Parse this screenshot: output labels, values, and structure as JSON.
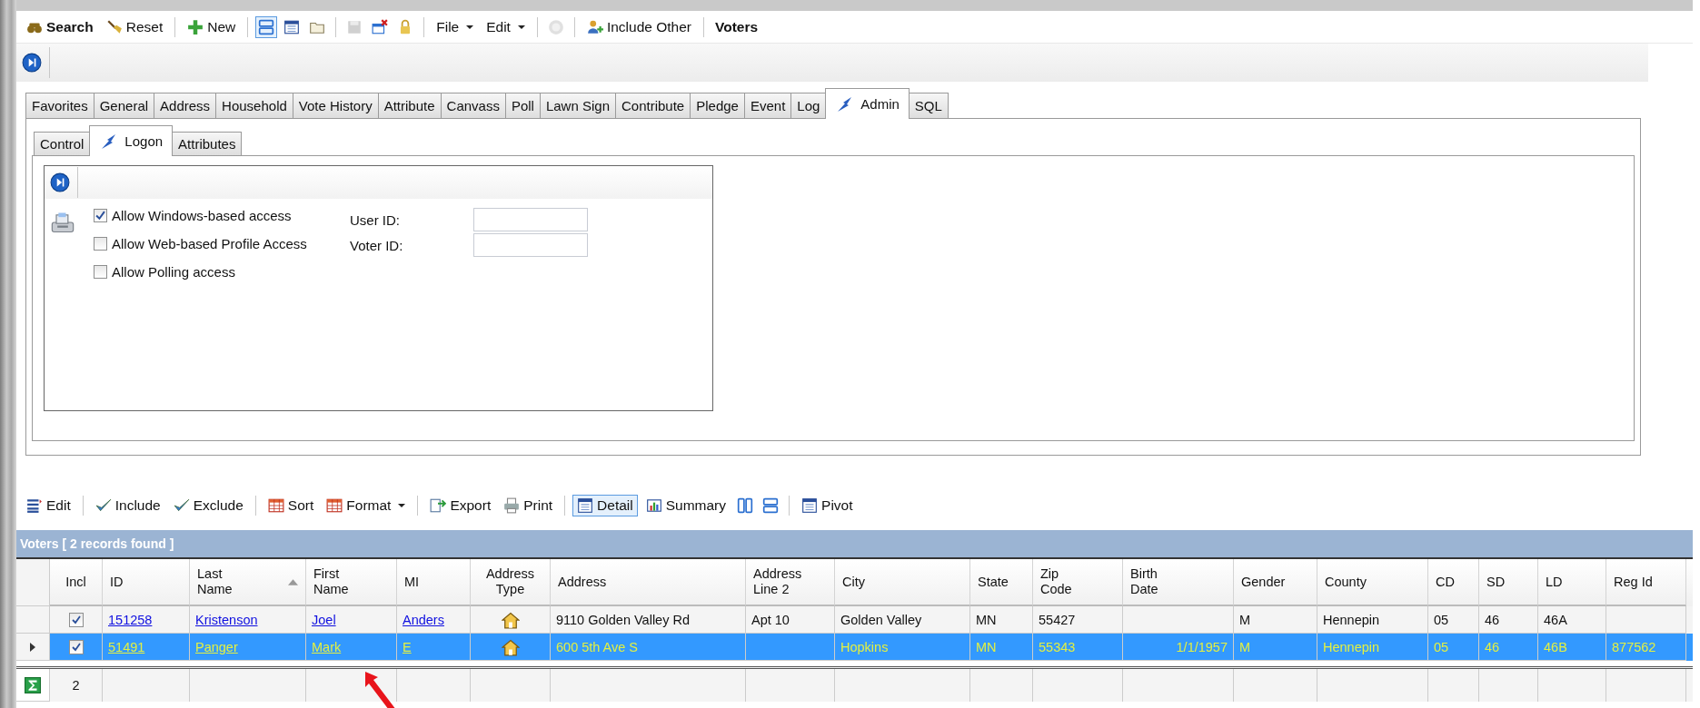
{
  "toolbar": {
    "groups": [
      [
        {
          "kind": "button",
          "label": "Search",
          "bold": true
        },
        {
          "kind": "button",
          "label": "Reset",
          "bold": false
        }
      ],
      [
        {
          "kind": "button",
          "label": "New",
          "bold": false
        }
      ],
      [
        {
          "kind": "icon",
          "selected": true,
          "disabled": false
        },
        {
          "kind": "icon",
          "selected": false,
          "disabled": false
        },
        {
          "kind": "icon",
          "selected": false,
          "disabled": false
        }
      ],
      [
        {
          "kind": "icon",
          "selected": false,
          "disabled": true
        },
        {
          "kind": "icon",
          "selected": false,
          "disabled": false
        },
        {
          "kind": "icon",
          "selected": false,
          "disabled": false
        }
      ],
      [
        {
          "kind": "menu",
          "label": "File",
          "bold": false
        },
        {
          "kind": "menu",
          "label": "Edit",
          "bold": false
        }
      ],
      [
        {
          "kind": "icon",
          "selected": false,
          "disabled": true
        }
      ],
      [
        {
          "kind": "button",
          "label": "Include Other",
          "bold": false
        }
      ],
      [
        {
          "kind": "title",
          "label": "Voters",
          "bold": true
        }
      ]
    ]
  },
  "tabs": [
    {
      "label": "Favorites",
      "selected": false
    },
    {
      "label": "General",
      "selected": false
    },
    {
      "label": "Address",
      "selected": false
    },
    {
      "label": "Household",
      "selected": false
    },
    {
      "label": "Vote History",
      "selected": false
    },
    {
      "label": "Attribute",
      "selected": false
    },
    {
      "label": "Canvass",
      "selected": false
    },
    {
      "label": "Poll",
      "selected": false
    },
    {
      "label": "Lawn Sign",
      "selected": false
    },
    {
      "label": "Contribute",
      "selected": false
    },
    {
      "label": "Pledge",
      "selected": false
    },
    {
      "label": "Event",
      "selected": false
    },
    {
      "label": "Log",
      "selected": false
    },
    {
      "label": "Admin",
      "selected": true
    },
    {
      "label": "SQL",
      "selected": false
    }
  ],
  "subtabs": [
    {
      "label": "Control",
      "selected": false
    },
    {
      "label": "Logon",
      "selected": true
    },
    {
      "label": "Attributes",
      "selected": false
    }
  ],
  "logon": {
    "options": [
      {
        "label": "Allow Windows-based access",
        "checked": true
      },
      {
        "label": "Allow Web-based Profile Access",
        "checked": false
      },
      {
        "label": "Allow Polling access",
        "checked": false
      }
    ],
    "fields": [
      {
        "label": "User ID:"
      },
      {
        "label": "Voter ID:"
      }
    ]
  },
  "grid_toolbar": {
    "groups": [
      [
        {
          "kind": "button",
          "label": "Edit",
          "selected": false
        }
      ],
      [
        {
          "kind": "button",
          "label": "Include",
          "selected": false
        },
        {
          "kind": "button",
          "label": "Exclude",
          "selected": false
        }
      ],
      [
        {
          "kind": "button",
          "label": "Sort",
          "selected": false
        },
        {
          "kind": "menu",
          "label": "Format",
          "selected": false
        }
      ],
      [
        {
          "kind": "button",
          "label": "Export",
          "selected": false
        },
        {
          "kind": "button",
          "label": "Print",
          "selected": false
        }
      ],
      [
        {
          "kind": "button",
          "label": "Detail",
          "selected": true
        },
        {
          "kind": "button",
          "label": "Summary",
          "selected": false
        },
        {
          "kind": "icon",
          "selected": false
        },
        {
          "kind": "icon",
          "selected": false
        }
      ],
      [
        {
          "kind": "button",
          "label": "Pivot",
          "selected": false
        }
      ]
    ]
  },
  "grid": {
    "title": "Voters [ 2 records found ]",
    "columns": [
      {
        "label": "Incl",
        "kind": "check",
        "sorted": false
      },
      {
        "label": "ID",
        "kind": "link",
        "sorted": false
      },
      {
        "label": "Last\nName",
        "kind": "link",
        "sorted": true
      },
      {
        "label": "First\nName",
        "kind": "link",
        "sorted": false
      },
      {
        "label": "MI",
        "kind": "link",
        "sorted": false
      },
      {
        "label": "Address\nType",
        "kind": "icon",
        "sorted": false
      },
      {
        "label": "Address",
        "kind": "text",
        "sorted": false
      },
      {
        "label": "Address\nLine 2",
        "kind": "text",
        "sorted": false
      },
      {
        "label": "City",
        "kind": "text",
        "sorted": false
      },
      {
        "label": "State",
        "kind": "text",
        "sorted": false
      },
      {
        "label": "Zip\nCode",
        "kind": "text",
        "sorted": false
      },
      {
        "label": "Birth\nDate",
        "kind": "date",
        "sorted": false
      },
      {
        "label": "Gender",
        "kind": "text",
        "sorted": false
      },
      {
        "label": "County",
        "kind": "text",
        "sorted": false
      },
      {
        "label": "CD",
        "kind": "text",
        "sorted": false
      },
      {
        "label": "SD",
        "kind": "text",
        "sorted": false
      },
      {
        "label": "LD",
        "kind": "text",
        "sorted": false
      },
      {
        "label": "Reg Id",
        "kind": "text",
        "sorted": false
      }
    ],
    "rows": [
      {
        "selected": false,
        "current": false,
        "cells": [
          true,
          "151258",
          "Kristenson",
          "Joel",
          "Anders",
          null,
          "9110 Golden Valley Rd",
          "Apt 10",
          "Golden Valley",
          "MN",
          "55427",
          null,
          "M",
          "Hennepin",
          "05",
          "46",
          "46A",
          null
        ]
      },
      {
        "selected": true,
        "current": true,
        "cells": [
          true,
          "51491",
          "Panger",
          "Mark",
          "E",
          null,
          "600 5th Ave S",
          null,
          "Hopkins",
          "MN",
          "55343",
          "1/1/1957",
          "M",
          "Hennepin",
          "05",
          "46",
          "46B",
          "877562"
        ]
      }
    ],
    "summary": "2"
  }
}
